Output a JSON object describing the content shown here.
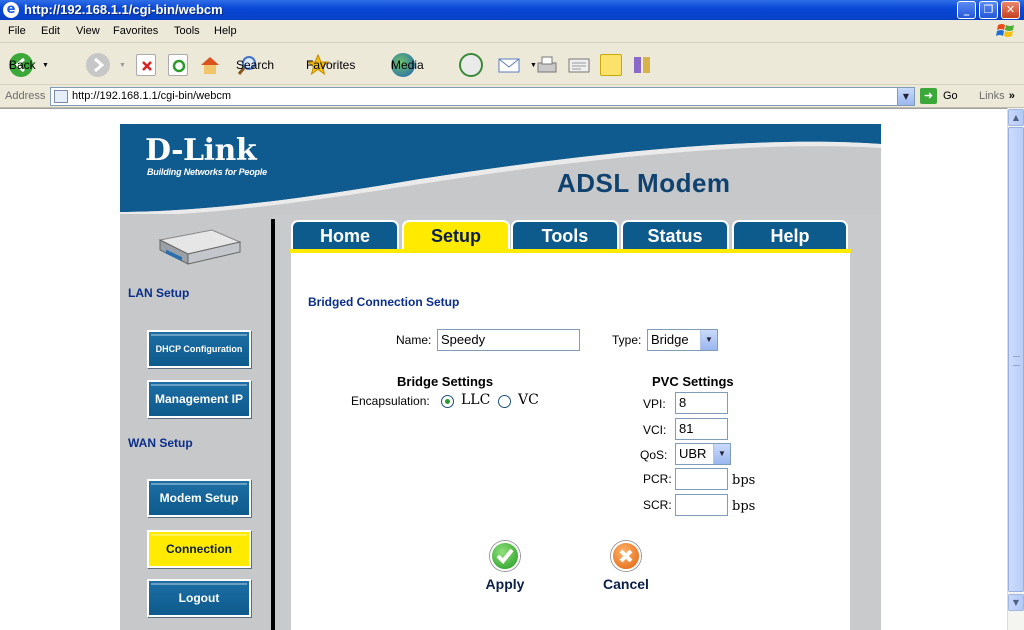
{
  "window": {
    "title": "http://192.168.1.1/cgi-bin/webcm",
    "min_icon": "minimize-icon",
    "max_icon": "restore-icon",
    "close_icon": "close-icon"
  },
  "menu": [
    "File",
    "Edit",
    "View",
    "Favorites",
    "Tools",
    "Help"
  ],
  "toolbar": {
    "back": "Back",
    "search": "Search",
    "favorites": "Favorites",
    "media": "Media"
  },
  "address": {
    "label": "Address",
    "url": "http://192.168.1.1/cgi-bin/webcm",
    "go": "Go",
    "links": "Links"
  },
  "page": {
    "brand": "D-Link",
    "tagline": "Building Networks for People",
    "product": "ADSL Modem"
  },
  "tabs": [
    {
      "label": "Home",
      "active": false
    },
    {
      "label": "Setup",
      "active": true
    },
    {
      "label": "Tools",
      "active": false
    },
    {
      "label": "Status",
      "active": false
    },
    {
      "label": "Help",
      "active": false
    }
  ],
  "sidebar": {
    "lan_heading": "LAN Setup",
    "wan_heading": "WAN Setup",
    "buttons": [
      {
        "label": "DHCP Configuration",
        "active": false
      },
      {
        "label": "Management IP",
        "active": false
      },
      {
        "label": "Modem Setup",
        "active": false
      },
      {
        "label": "Connection",
        "active": true
      },
      {
        "label": "Logout",
        "active": false
      }
    ]
  },
  "form": {
    "heading": "Bridged Connection Setup",
    "name_label": "Name:",
    "name_value": "Speedy",
    "type_label": "Type:",
    "type_value": "Bridge",
    "bridge_heading": "Bridge Settings",
    "encap_label": "Encapsulation:",
    "encap_options": [
      "LLC",
      "VC"
    ],
    "encap_selected": "LLC",
    "pvc_heading": "PVC Settings",
    "vpi_label": "VPI:",
    "vpi_value": "8",
    "vci_label": "VCI:",
    "vci_value": "81",
    "qos_label": "QoS:",
    "qos_value": "UBR",
    "pcr_label": "PCR:",
    "pcr_value": "",
    "pcr_unit": "bps",
    "scr_label": "SCR:",
    "scr_value": "",
    "scr_unit": "bps",
    "apply": "Apply",
    "cancel": "Cancel"
  },
  "colors": {
    "header_blue": "#0f5b8f",
    "nav_button": "#0e5a8c",
    "active_yellow": "#ffea00",
    "heading_navy": "#0a2e8a"
  }
}
